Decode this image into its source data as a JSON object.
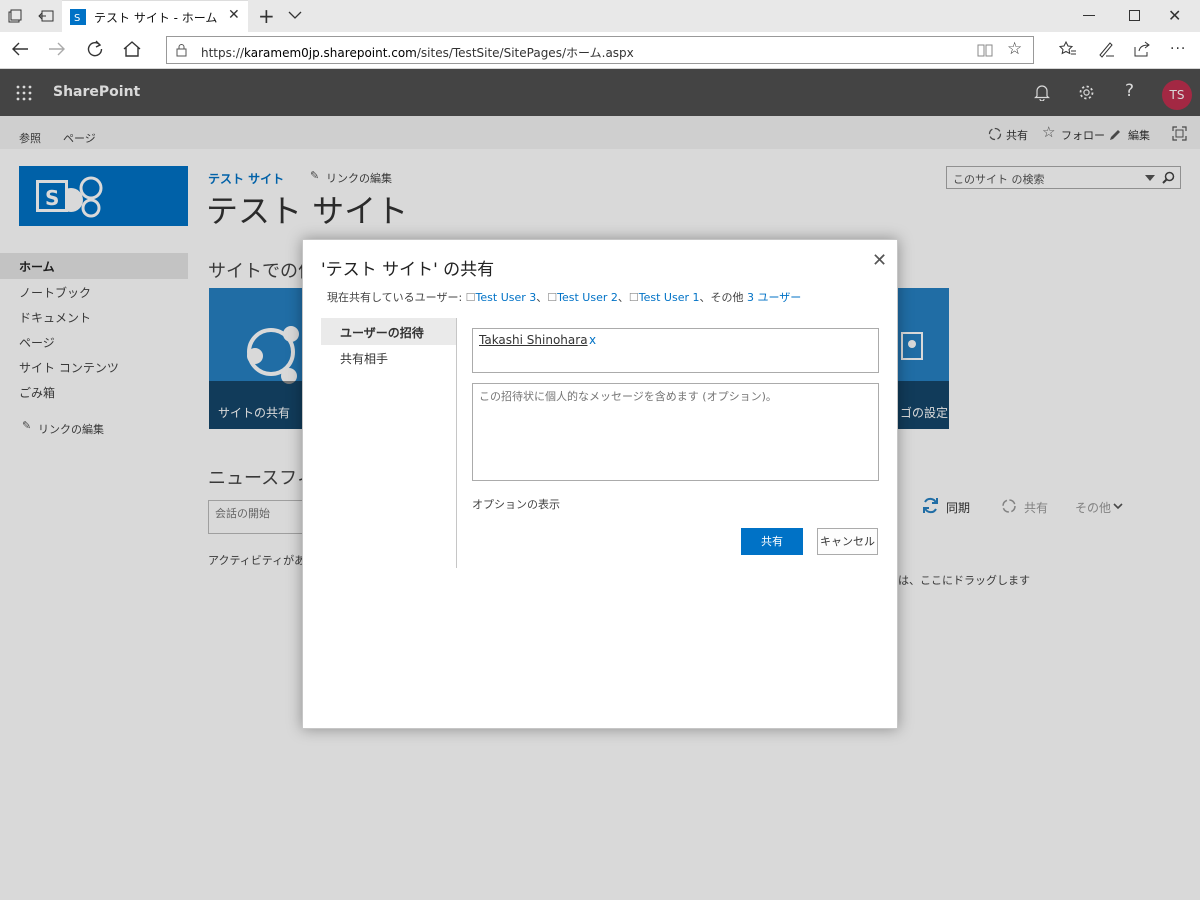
{
  "browser": {
    "tab_title": "テスト サイト - ホーム",
    "url_prefix": "https://",
    "url_host": "karamem0jp.sharepoint.com",
    "url_path": "/sites/TestSite/SitePages/ホーム.aspx"
  },
  "suite": {
    "title": "SharePoint",
    "avatar_initials": "TS"
  },
  "ribbon": {
    "tabs": [
      "参照",
      "ページ"
    ],
    "share": "共有",
    "follow": "フォロー",
    "edit": "編集"
  },
  "site": {
    "breadcrumb": "テスト サイト",
    "edit_links": "リンクの編集",
    "title": "テスト サイト",
    "search_placeholder": "このサイト の検索"
  },
  "leftnav": {
    "items": [
      "ホーム",
      "ノートブック",
      "ドキュメント",
      "ページ",
      "サイト コンテンツ",
      "ごみ箱"
    ],
    "edit_links": "リンクの編集"
  },
  "main": {
    "work_heading": "サイトでの作業",
    "tile_share": "サイトの共有",
    "tile_logo": "ゴの設定",
    "newsfeed_heading": "ニュースフィー",
    "conversation_placeholder": "会話の開始",
    "activity": "アクティビティがありま",
    "drag_hint": "は、ここにドラッグします",
    "sync": "同期",
    "share": "共有",
    "more": "その他"
  },
  "dialog": {
    "title": "'テスト サイト' の共有",
    "shared_prefix": "現在共有しているユーザー:",
    "shared_users": [
      "Test User 3",
      "Test User 2",
      "Test User 1"
    ],
    "shared_other_prefix": "、その他",
    "shared_other_link": "3 ユーザー",
    "tabs": [
      "ユーザーの招待",
      "共有相手"
    ],
    "invitee": "Takashi Shinohara",
    "invitee_remove": "x",
    "message_placeholder": "この招待状に個人的なメッセージを含めます (オプション)。",
    "show_options": "オプションの表示",
    "share_button": "共有",
    "cancel_button": "キャンセル"
  },
  "colors": {
    "suite_bar": "#505050",
    "accent": "#0072c6",
    "avatar": "#c0304f"
  }
}
